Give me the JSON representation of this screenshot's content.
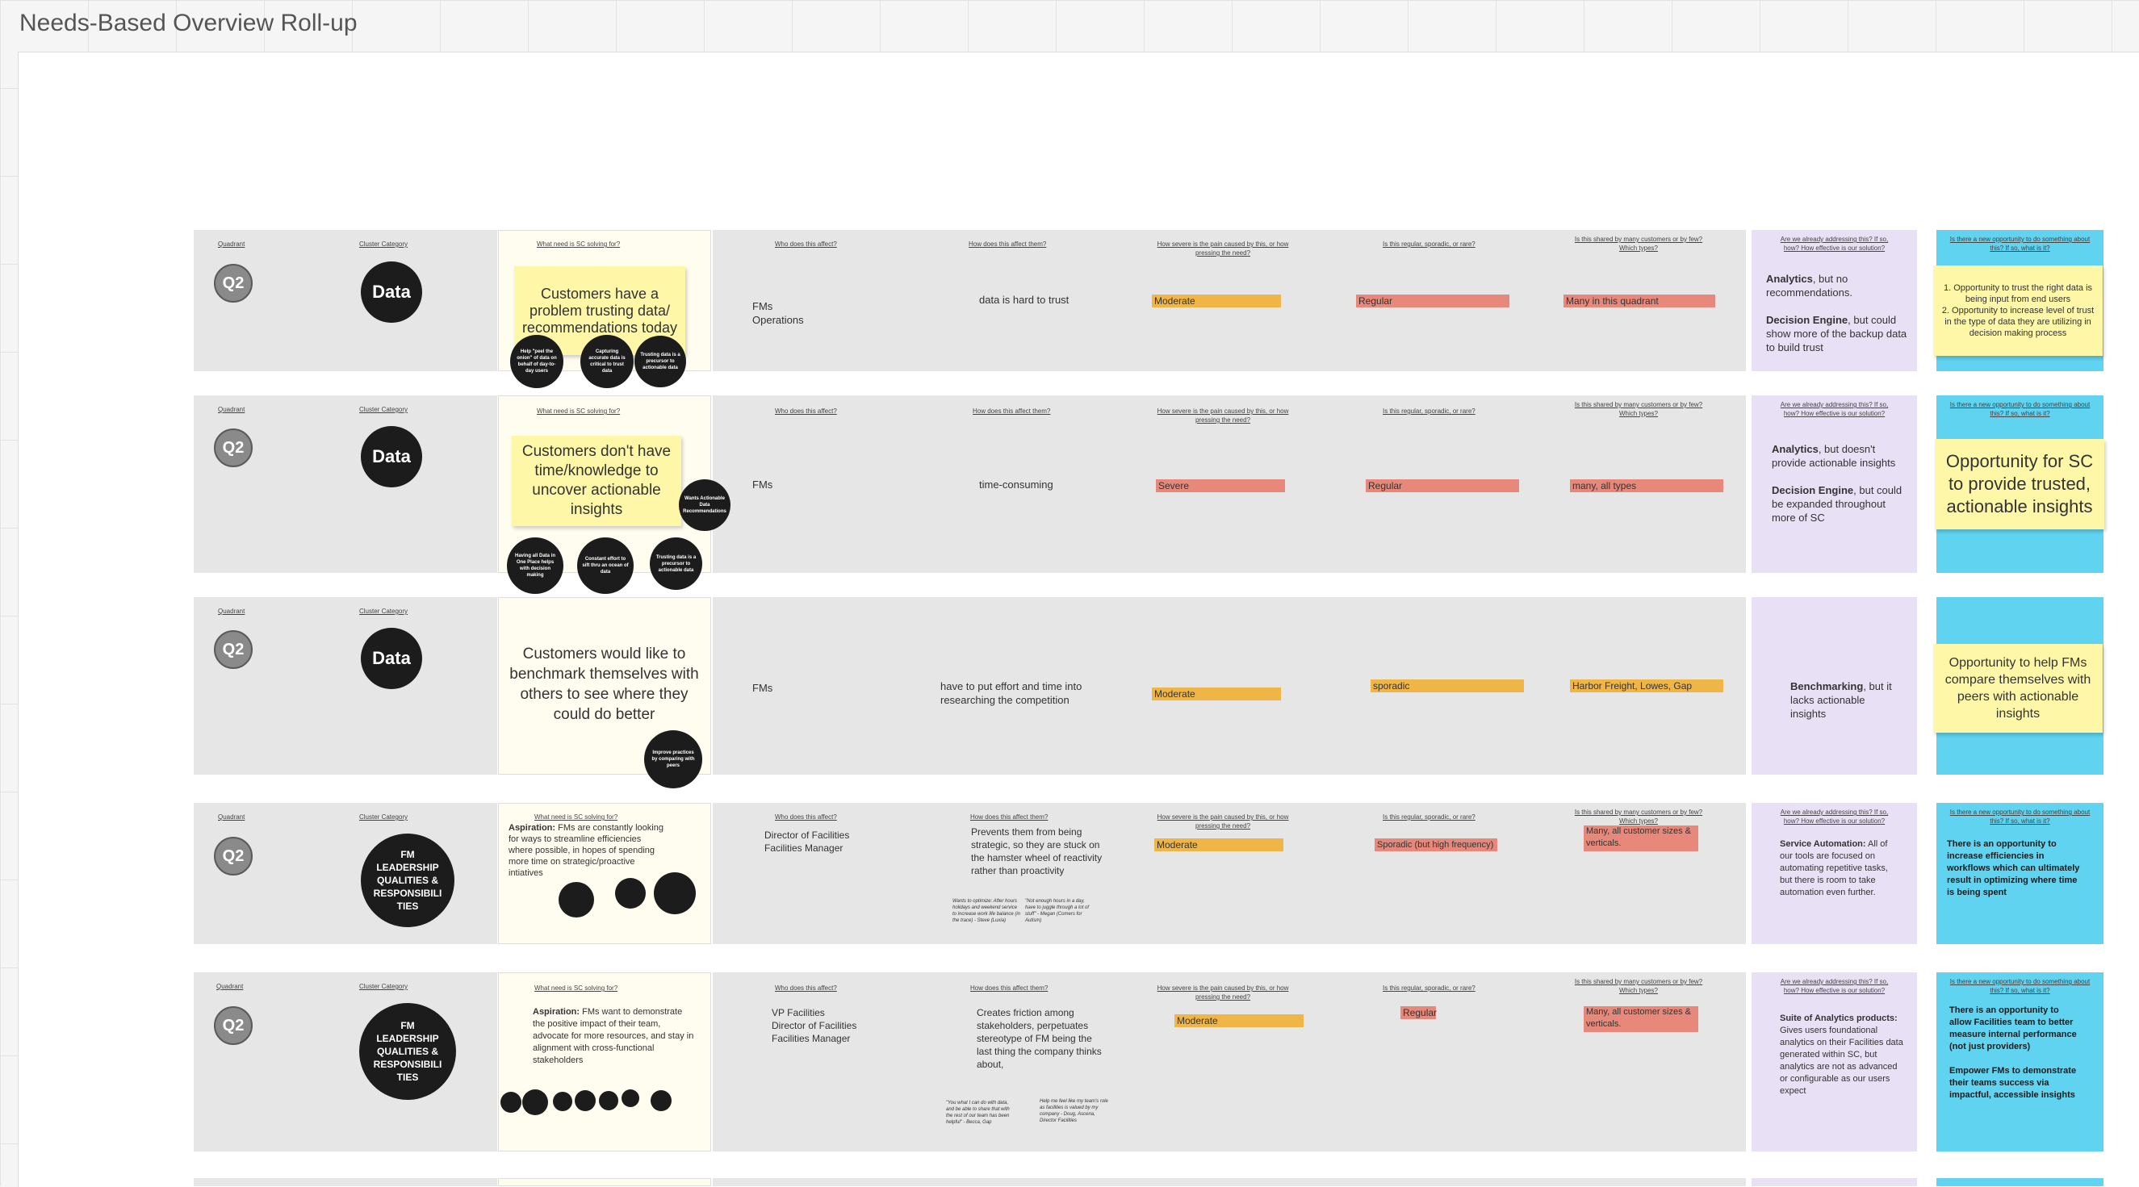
{
  "board": {
    "title": "Needs-Based Overview Roll-up"
  },
  "headers": {
    "quadrant": "Quadrant",
    "cluster": "Cluster Category",
    "need": "What need is SC solving for?",
    "who": "Who does this affect?",
    "how": "How does this affect them?",
    "severity": "How severe is the pain caused by this, or how pressing the need?",
    "frequency": "Is this regular, sporadic, or rare?",
    "shared": "Is this shared by many customers or by few? Which types?",
    "addressing": "Are we already addressing this? If so, how? How effective is our solution?",
    "opportunity": "Is there a new opportunity to do something about this? If so, what is it?"
  },
  "rows": [
    {
      "quadrant": "Q2",
      "category": "Data",
      "need": "Customers have a problem trusting data/ recommendations today",
      "dots": [
        "Help \"peel the onion\" of data on behalf of day-to-day users",
        "Capturing accurate data is critical to trust data",
        "Trusting data is a precursor to actionable data"
      ],
      "who": "FMs\nOperations",
      "how": "data is hard to trust",
      "severity": "Moderate",
      "frequency": "Regular",
      "shared": "Many in this quadrant",
      "addr_b1": "Analytics",
      "addr_t1": ", but no recommendations.",
      "addr_b2": "Decision Engine",
      "addr_t2": ", but could show more of the backup data to build trust",
      "opportunity": "1. Opportunity to trust the right data is being input from end users\n2. Opportunity to increase level of trust in the type of data they are utilizing in decision making process"
    },
    {
      "quadrant": "Q2",
      "category": "Data",
      "need": "Customers don't have time/knowledge to uncover actionable insights",
      "dots": [
        "Wants Actionable Data Recommendations",
        "Having all Data in One Place helps with decision making",
        "Constant effort to sift thru an ocean of data",
        "Trusting data is a precursor to actionable data"
      ],
      "who": "FMs",
      "how": "time-consuming",
      "severity": "Severe",
      "frequency": "Regular",
      "shared": "many, all types",
      "addr_b1": "Analytics",
      "addr_t1": ", but doesn't provide actionable insights",
      "addr_b2": "Decision Engine",
      "addr_t2": ", but could be expanded throughout more of SC",
      "opportunity": "Opportunity for SC to provide trusted, actionable insights"
    },
    {
      "quadrant": "Q2",
      "category": "Data",
      "need": "Customers would like to benchmark themselves with others to see where they could do better",
      "dots": [
        "Improve practices by comparing with peers"
      ],
      "who": "FMs",
      "how": "have to put effort and time into researching the competition",
      "severity": "Moderate",
      "frequency": "sporadic",
      "shared": "Harbor Freight, Lowes, Gap",
      "addr_b1": "Benchmarking",
      "addr_t1": ", but it lacks actionable insights",
      "opportunity": "Opportunity to help FMs compare themselves with peers with actionable insights"
    },
    {
      "quadrant": "Q2",
      "category": "FM LEADERSHIP QUALITIES & RESPONSIBILI TIES",
      "need_b": "Aspiration:",
      "need_t": " FMs are constantly looking for ways to streamline efficiencies where possible, in hopes of spending more time on strategic/proactive intiatives",
      "who": "Director of Facilities\nFacilities Manager",
      "how": "Prevents them from being strategic, so they are stuck on the hamster wheel of reactivity rather than proactivity",
      "quote1": "Wants to optimize: After hours holidays and weekend service to increase work life balance (in the trace) - Steve (Luxia)",
      "quote2": "\"Not enough hours in a day, have to juggle through a lot of stuff\" - Megan (Comers for Autism)",
      "severity": "Moderate",
      "frequency": "Sporadic (but high frequency)",
      "shared": "Many, all customer sizes & verticals.",
      "addr_b1": "Service Automation:",
      "addr_t1": " All of our tools are focused on automating repetitive tasks, but there is room to take automation even further.",
      "opportunity": "There is an opportunity to increase efficiencies in workflows which can ultimately result in optimizing where time is being spent"
    },
    {
      "quadrant": "Q2",
      "category": "FM LEADERSHIP QUALITIES & RESPONSIBILI TIES",
      "need_b": "Aspiration:",
      "need_t": " FMs want to demonstrate the positive impact of their team, advocate for more resources, and stay in alignment with cross-functional stakeholders",
      "who": "VP Facilities\nDirector of Facilities\nFacilities Manager",
      "how": "Creates friction among stakeholders, perpetuates stereotype of FM being the last thing the company thinks about,",
      "quote1": "\"You what I can do with data, and be able to share that with the rest of our team has been helpful\" - Becca, Gap",
      "quote2": "Help me feel like my team's role as facilities is valued by my company - Doug, Ascena, Director Facilities",
      "severity": "Moderate",
      "frequency": "Regular",
      "shared": "Many, all customer sizes & verticals.",
      "addr_b1": "Suite of Analytics products:",
      "addr_t1": " Gives users foundational analytics on their Facilities data generated within SC, but analytics are not as advanced or configurable as our users expect",
      "opportunity": "There is an opportunity to allow Facilities team to better measure internal performance (not just providers)\n\nEmpower FMs to demonstrate their teams success via impactful, accessible insights"
    }
  ]
}
